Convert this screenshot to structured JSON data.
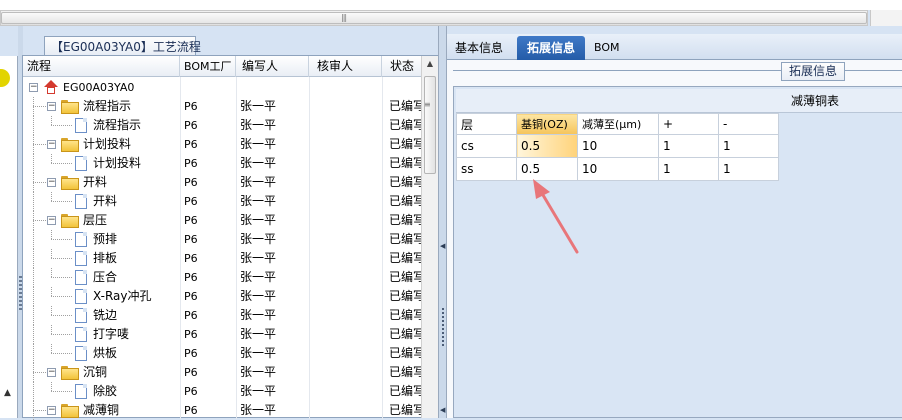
{
  "window": {
    "scrollbar_grip": "|||"
  },
  "left_pane": {
    "process_tab": "【EG00A03YA0】工艺流程",
    "columns": [
      "流程",
      "BOM工厂",
      "编写人",
      "核审人",
      "状态"
    ],
    "sort_indicator": "▲",
    "rows": [
      {
        "name": "EG00A03YA0",
        "type": "root",
        "level": 0,
        "bom": "",
        "writer": "",
        "reviewer": "",
        "status": ""
      },
      {
        "name": "流程指示",
        "type": "folder",
        "level": 1,
        "bom": "P6",
        "writer": "张一平",
        "reviewer": "",
        "status": "已编写"
      },
      {
        "name": "流程指示",
        "type": "doc",
        "level": 2,
        "bom": "P6",
        "writer": "张一平",
        "reviewer": "",
        "status": "已编写"
      },
      {
        "name": "计划投料",
        "type": "folder",
        "level": 1,
        "bom": "P6",
        "writer": "张一平",
        "reviewer": "",
        "status": "已编写"
      },
      {
        "name": "计划投料",
        "type": "doc",
        "level": 2,
        "bom": "P6",
        "writer": "张一平",
        "reviewer": "",
        "status": "已编写"
      },
      {
        "name": "开料",
        "type": "folder",
        "level": 1,
        "bom": "P6",
        "writer": "张一平",
        "reviewer": "",
        "status": "已编写"
      },
      {
        "name": "开料",
        "type": "doc",
        "level": 2,
        "bom": "P6",
        "writer": "张一平",
        "reviewer": "",
        "status": "已编写"
      },
      {
        "name": "层压",
        "type": "folder",
        "level": 1,
        "bom": "P6",
        "writer": "张一平",
        "reviewer": "",
        "status": "已编写"
      },
      {
        "name": "预排",
        "type": "doc",
        "level": 2,
        "bom": "P6",
        "writer": "张一平",
        "reviewer": "",
        "status": "已编写"
      },
      {
        "name": "排板",
        "type": "doc",
        "level": 2,
        "bom": "P6",
        "writer": "张一平",
        "reviewer": "",
        "status": "已编写"
      },
      {
        "name": "压合",
        "type": "doc",
        "level": 2,
        "bom": "P6",
        "writer": "张一平",
        "reviewer": "",
        "status": "已编写"
      },
      {
        "name": "X-Ray冲孔",
        "type": "doc",
        "level": 2,
        "bom": "P6",
        "writer": "张一平",
        "reviewer": "",
        "status": "已编写"
      },
      {
        "name": "铣边",
        "type": "doc",
        "level": 2,
        "bom": "P6",
        "writer": "张一平",
        "reviewer": "",
        "status": "已编写"
      },
      {
        "name": "打字唛",
        "type": "doc",
        "level": 2,
        "bom": "P6",
        "writer": "张一平",
        "reviewer": "",
        "status": "已编写"
      },
      {
        "name": "烘板",
        "type": "doc",
        "level": 2,
        "bom": "P6",
        "writer": "张一平",
        "reviewer": "",
        "status": "已编写"
      },
      {
        "name": "沉铜",
        "type": "folder",
        "level": 1,
        "bom": "P6",
        "writer": "张一平",
        "reviewer": "",
        "status": "已编写"
      },
      {
        "name": "除胶",
        "type": "doc",
        "level": 2,
        "bom": "P6",
        "writer": "张一平",
        "reviewer": "",
        "status": "已编写"
      },
      {
        "name": "减薄铜",
        "type": "folder",
        "level": 1,
        "bom": "P6",
        "writer": "张一平",
        "reviewer": "",
        "status": "已编写"
      }
    ]
  },
  "right_pane": {
    "tabs": [
      "基本信息",
      "拓展信息",
      "BOM"
    ],
    "active_tab": "拓展信息",
    "section_label": "拓展信息",
    "grid_title": "减薄铜表",
    "grid_headers": [
      "层",
      "基铜(OZ)",
      "减薄至(μm)",
      "+",
      "-"
    ],
    "grid_rows": [
      [
        "cs",
        "0.5",
        "10",
        "1",
        "1"
      ],
      [
        "ss",
        "0.5",
        "10",
        "1",
        "1"
      ]
    ],
    "annotation_color": "#e8767a"
  }
}
